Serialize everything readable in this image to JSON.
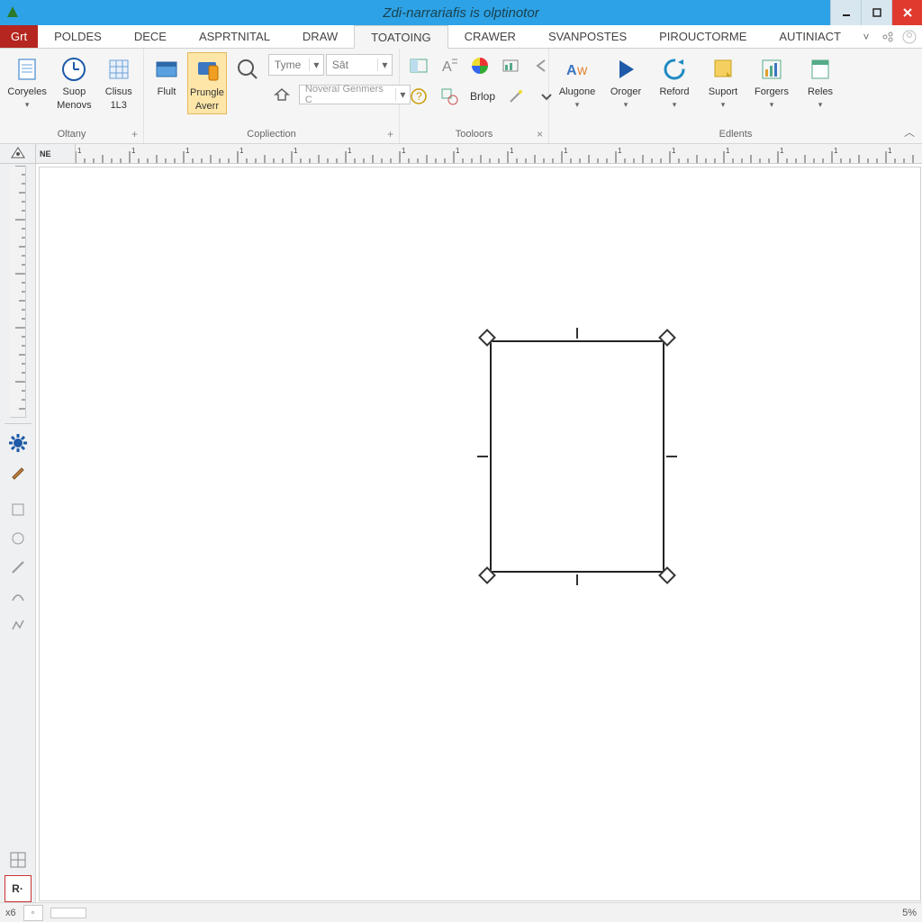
{
  "titlebar": {
    "title": "Zdi-narrariafis is olptinotor"
  },
  "tabs": {
    "file": "Grt",
    "items": [
      "POLDES",
      "DECE",
      "ASPRTNITAL",
      "DRAW",
      "TOATOING",
      "CRAWER",
      "SVANPOSTES",
      "PIROUCTORME",
      "AUTINIACT"
    ],
    "active_index": 4
  },
  "ribbon": {
    "groups": [
      {
        "label": "Oltany",
        "has_plus": true
      },
      {
        "label": "Copliection",
        "has_plus": true
      },
      {
        "label": "Tooloors",
        "has_x": true
      },
      {
        "label": "Edlents"
      }
    ],
    "btn_coryeles": "Coryeles",
    "btn_suop": "Suop",
    "btn_suop2": "Menovs",
    "btn_clisus": "Clisus",
    "btn_clisus2": "1L3",
    "btn_flult": "Flult",
    "btn_prungle": "Prungle",
    "btn_prungle2": "Averr",
    "combo_type": "Tyme",
    "combo_val": "Sât",
    "btn_noveral": "Noveraî Genmers C",
    "btn_brlop": "Brlop",
    "btn_alugone": "Alugone",
    "btn_oroger": "Oroger",
    "btn_reford": "Reford",
    "btn_suport": "Suport",
    "btn_forgers": "Forgers",
    "btn_reles": "Reles"
  },
  "ruler_badge": "NE",
  "status": {
    "left": "x6",
    "right": "5%"
  }
}
